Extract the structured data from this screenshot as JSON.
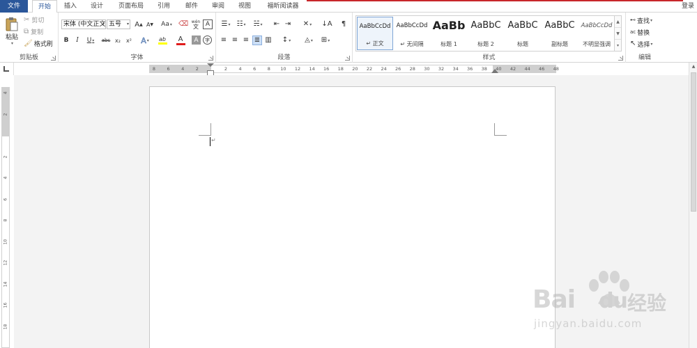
{
  "menu": {
    "tabs": [
      {
        "label": "文件"
      },
      {
        "label": "开始"
      },
      {
        "label": "插入"
      },
      {
        "label": "设计"
      },
      {
        "label": "页面布局"
      },
      {
        "label": "引用"
      },
      {
        "label": "邮件"
      },
      {
        "label": "审阅"
      },
      {
        "label": "视图"
      },
      {
        "label": "福昕阅读器"
      }
    ],
    "login": "登录"
  },
  "clipboard": {
    "paste": "粘贴",
    "cut": "剪切",
    "copy": "复制",
    "format_painter": "格式刷",
    "label": "剪贴板"
  },
  "font": {
    "name": "宋体 (中文正文",
    "size": "五号",
    "label": "字体",
    "grow": "A",
    "shrink": "A",
    "change_case": "Aa",
    "wen": "wén",
    "bold": "B",
    "italic": "I",
    "underline": "U",
    "strike": "abc",
    "sub": "x₂",
    "sup": "x²",
    "effects": "A",
    "highlight": "ab",
    "color": "A",
    "shade": "A",
    "enclose": "字"
  },
  "paragraph": {
    "label": "段落"
  },
  "styles": {
    "label": "样式",
    "items": [
      {
        "sample": "AaBbCcDd",
        "name": "↵ 正文"
      },
      {
        "sample": "AaBbCcDd",
        "name": "↵ 无间隔"
      },
      {
        "sample": "AaBb",
        "name": "标题 1"
      },
      {
        "sample": "AaBbC",
        "name": "标题 2"
      },
      {
        "sample": "AaBbC",
        "name": "标题"
      },
      {
        "sample": "AaBbC",
        "name": "副标题"
      },
      {
        "sample": "AaBbCcDd",
        "name": "不明显强调"
      }
    ]
  },
  "editing": {
    "find": "查找",
    "replace": "替换",
    "select": "选择",
    "label": "编辑"
  },
  "ruler": {
    "h_ticks": [
      "8",
      "6",
      "4",
      "2",
      "",
      "2",
      "4",
      "6",
      "8",
      "10",
      "12",
      "14",
      "16",
      "18",
      "20",
      "22",
      "24",
      "26",
      "28",
      "30",
      "32",
      "34",
      "36",
      "38",
      "40",
      "42",
      "44",
      "46",
      "48"
    ],
    "v_ticks": [
      "4",
      "2",
      "",
      "2",
      "4",
      "6",
      "8",
      "10",
      "12",
      "14",
      "16",
      "18"
    ]
  },
  "document": {
    "para_mark": "↵"
  },
  "watermark": {
    "brand": "Bai",
    "brand_du": "du",
    "brand_cn": "经验",
    "url": "jingyan.baidu.com"
  },
  "colors": {
    "accent": "#2b579a",
    "menu_red_line": "#c8262a",
    "font_color_bar": "#e01c1c",
    "highlight_bar": "#ffff00"
  }
}
